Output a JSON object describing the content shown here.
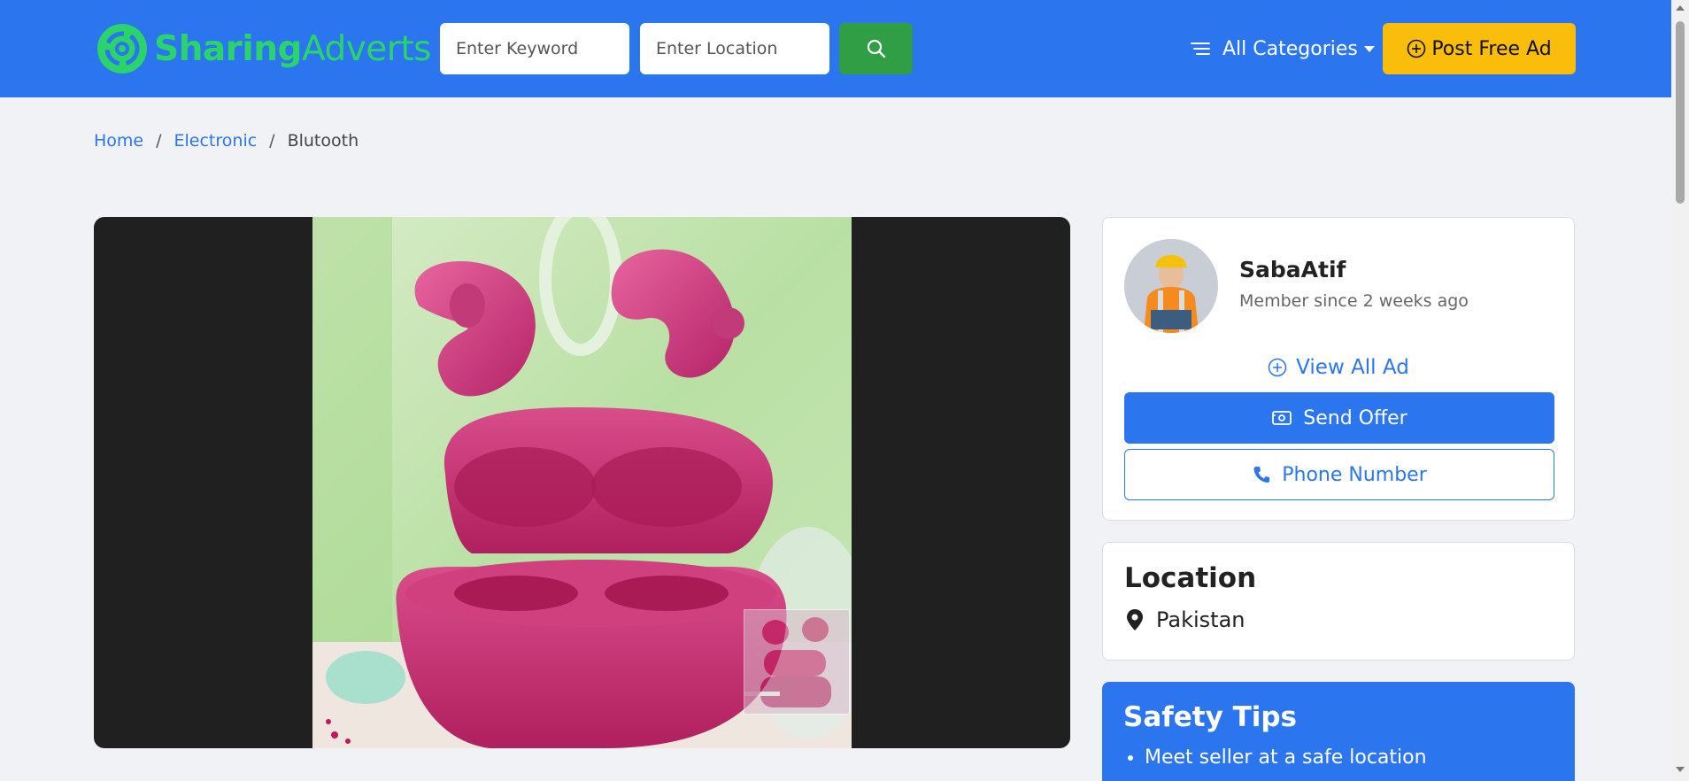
{
  "brand": {
    "name_part1": "Sharing",
    "name_part2": "Adverts",
    "color": "#2bd46b"
  },
  "header": {
    "keyword_placeholder": "Enter Keyword",
    "location_placeholder": "Enter Location",
    "search_icon": "search-icon",
    "categories_label": "All Categories",
    "post_label": "Post Free Ad",
    "bg_color": "#2b76ee",
    "post_color": "#fbbd0b",
    "search_color": "#2f9e44"
  },
  "breadcrumb": {
    "items": [
      "Home",
      "Electronic",
      "Blutooth"
    ],
    "separator": "/"
  },
  "gallery": {
    "main_image": "pink wireless earbuds with open charging case",
    "thumbnail": "pink earbuds thumbnail"
  },
  "seller": {
    "name": "SabaAtif",
    "member_since": "Member since 2 weeks ago",
    "view_all": "View All Ad",
    "send_offer": "Send Offer",
    "phone": "Phone Number"
  },
  "location": {
    "title": "Location",
    "value": "Pakistan"
  },
  "safety": {
    "title": "Safety Tips",
    "tips": [
      "Meet seller at a safe location"
    ]
  }
}
